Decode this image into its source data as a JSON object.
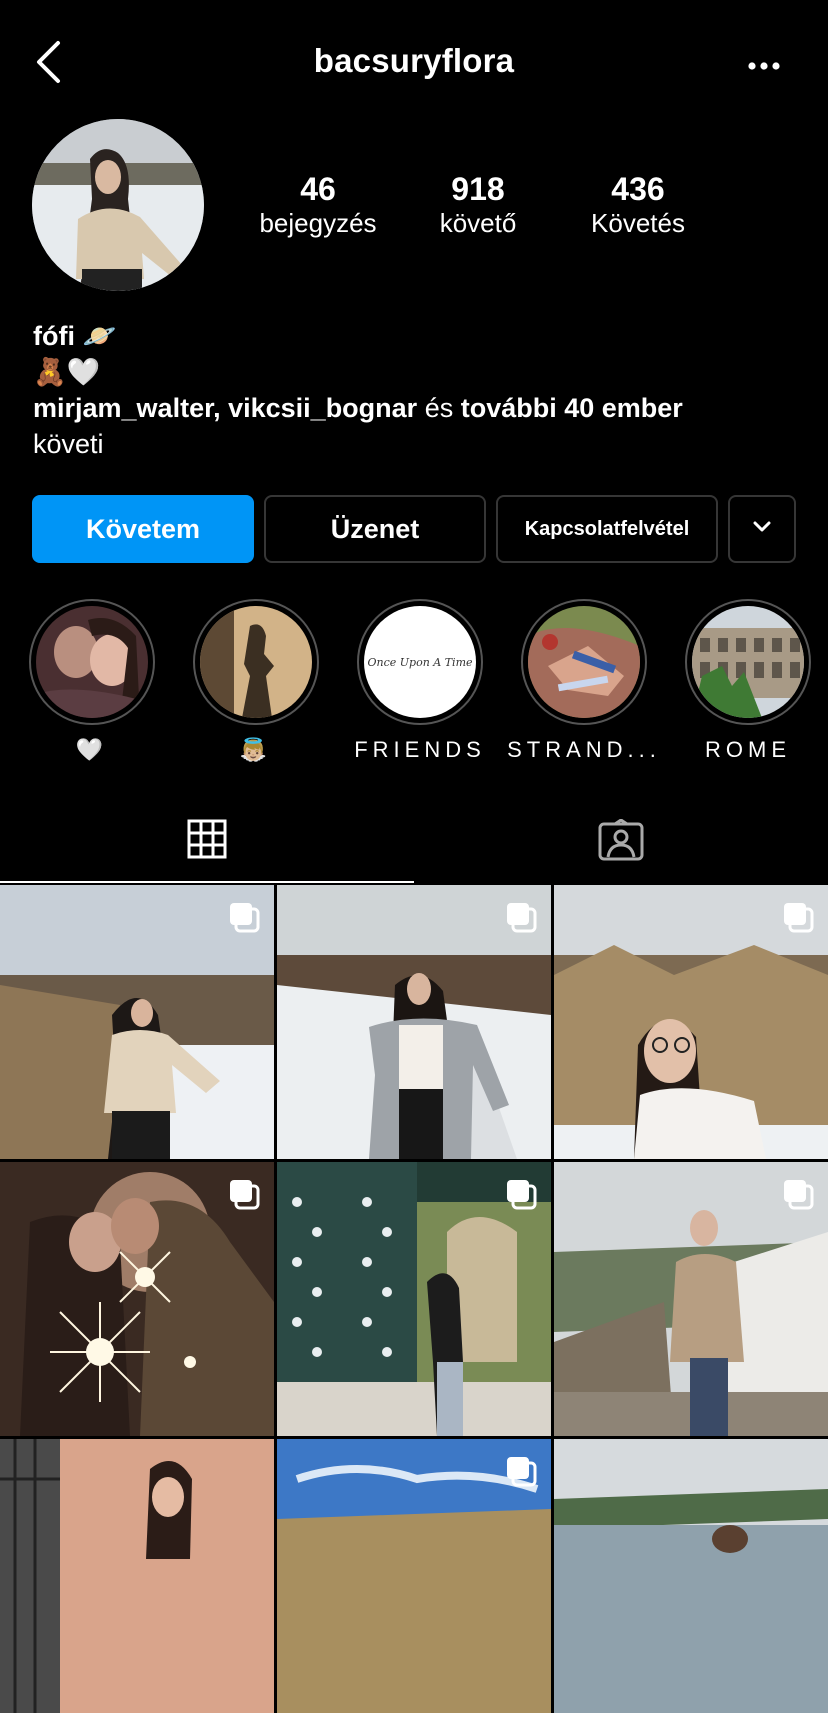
{
  "header": {
    "username": "bacsuryflora",
    "back_icon": "chevron-left-icon",
    "more_icon": "more-horizontal-icon"
  },
  "profile": {
    "stats": [
      {
        "value": "46",
        "label": "bejegyzés"
      },
      {
        "value": "918",
        "label": "követő"
      },
      {
        "value": "436",
        "label": "Követés"
      }
    ],
    "bio": {
      "name": "fófi 🪐",
      "line2": "🧸🤍",
      "followed_by_names": "mirjam_walter, vikcsii_bognar",
      "followed_by_and": " és ",
      "followed_by_more": "további 40 ember",
      "followed_by_suffix": "követi"
    }
  },
  "actions": {
    "follow": "Követem",
    "message": "Üzenet",
    "contact": "Kapcsolatfelvétel",
    "more_icon": "chevron-down-icon",
    "follow_color": "#0095f6"
  },
  "highlights": [
    {
      "label": "🤍"
    },
    {
      "label": "👼🏼"
    },
    {
      "label": "FRIENDS",
      "cover_text": "Once Upon A Time"
    },
    {
      "label": "STRAND..."
    },
    {
      "label": "ROME"
    }
  ],
  "tabs": {
    "grid_icon": "grid-icon",
    "tagged_icon": "tagged-user-icon"
  },
  "posts": [
    {
      "scene": "woman in beige sweater by frozen lake",
      "multi": true
    },
    {
      "scene": "woman in grey coat on snowy path",
      "multi": true
    },
    {
      "scene": "smiling woman with glasses in reeds",
      "multi": true
    },
    {
      "scene": "couple kissing with sparklers",
      "multi": true
    },
    {
      "scene": "woman under ornate green pavilion",
      "multi": true
    },
    {
      "scene": "woman on terrace overlooking valley",
      "multi": true
    },
    {
      "scene": "woman against pink wall",
      "multi": false
    },
    {
      "scene": "blue sky over reeds",
      "multi": true
    },
    {
      "scene": "lake landscape",
      "multi": false
    }
  ]
}
